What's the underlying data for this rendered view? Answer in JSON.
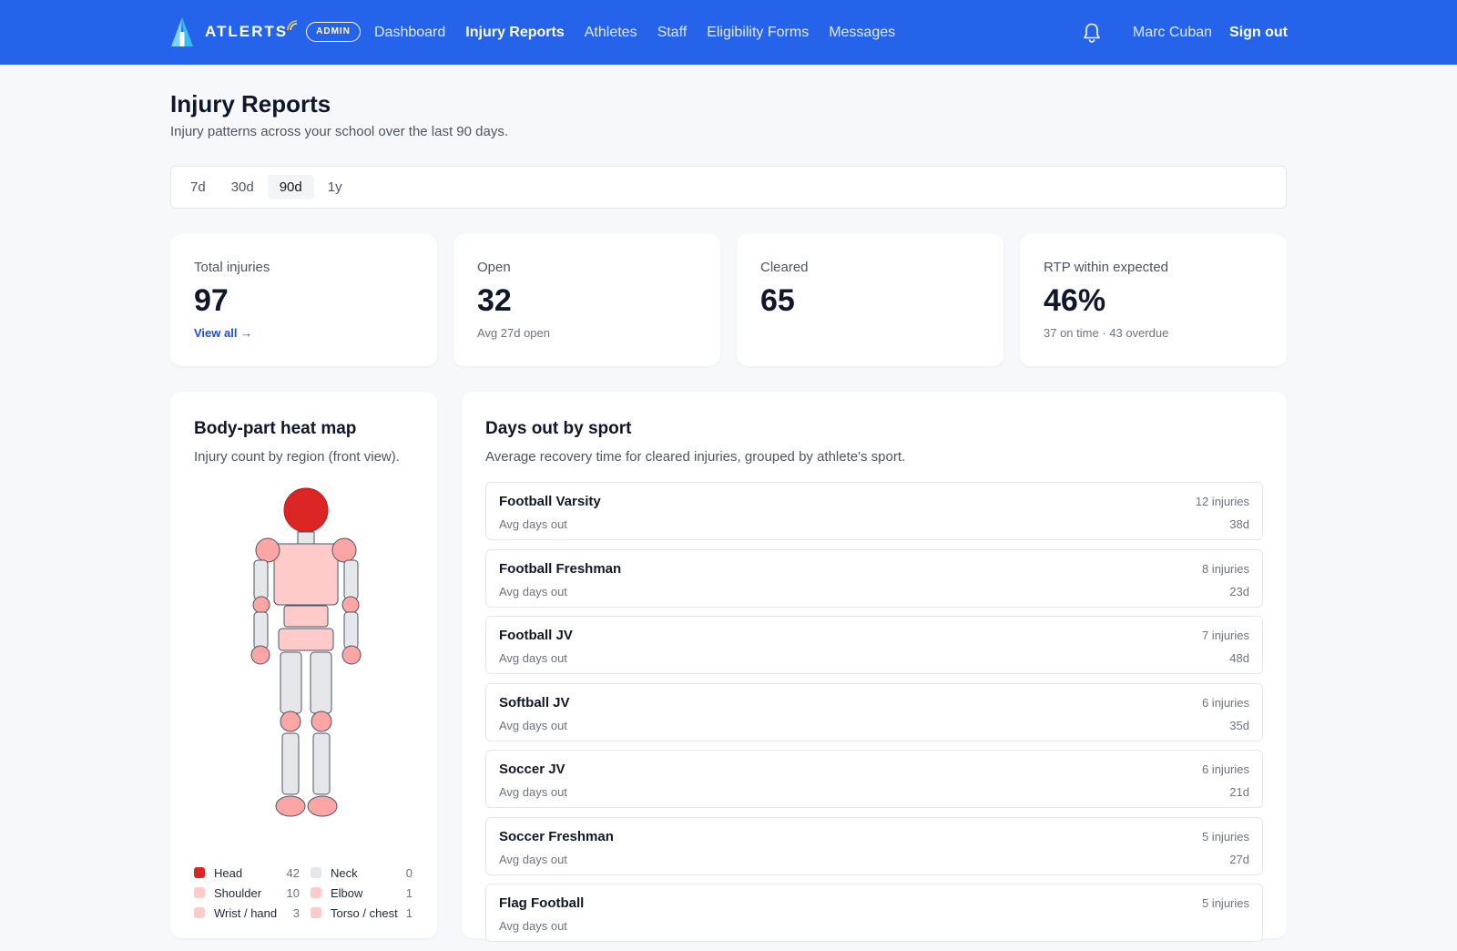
{
  "header": {
    "brand": "ATLERTS",
    "badge": "ADMIN",
    "nav": [
      {
        "label": "Dashboard",
        "active": false
      },
      {
        "label": "Injury Reports",
        "active": true
      },
      {
        "label": "Athletes",
        "active": false
      },
      {
        "label": "Staff",
        "active": false
      },
      {
        "label": "Eligibility Forms",
        "active": false
      },
      {
        "label": "Messages",
        "active": false
      }
    ],
    "icons": {
      "notifications": "bell-icon",
      "logo": "atlerts-logo-icon"
    },
    "user_name": "Marc Cuban",
    "sign_out": "Sign out",
    "accent_color": "#2563eb"
  },
  "page": {
    "title": "Injury Reports",
    "subtitle": "Injury patterns across your school over the last 90 days."
  },
  "range": {
    "tabs": [
      "7d",
      "30d",
      "90d",
      "1y"
    ],
    "selected": "90d"
  },
  "stats": {
    "total": {
      "label": "Total injuries",
      "value": "97",
      "link": "View all →"
    },
    "open": {
      "label": "Open",
      "value": "32",
      "foot": "Avg 27d open"
    },
    "cleared": {
      "label": "Cleared",
      "value": "65"
    },
    "rtp": {
      "label": "RTP within expected",
      "value": "46%",
      "foot": "37 on time · 43 overdue"
    }
  },
  "heatmap": {
    "title": "Body-part heat map",
    "subtitle": "Injury count by region (front view).",
    "colors": {
      "high": "#dc2626",
      "mid": "#fca5a5",
      "low": "#fecaca",
      "none": "#e5e7eb"
    },
    "legend": [
      [
        {
          "label": "Head",
          "count": "42",
          "color": "#dc2626"
        },
        {
          "label": "Neck",
          "count": "0",
          "color": "#e5e7eb"
        }
      ],
      [
        {
          "label": "Shoulder",
          "count": "10",
          "color": "#fecaca"
        },
        {
          "label": "Elbow",
          "count": "1",
          "color": "#fecaca"
        }
      ],
      [
        {
          "label": "Wrist / hand",
          "count": "3",
          "color": "#fecaca"
        },
        {
          "label": "Torso / chest",
          "count": "1",
          "color": "#fecaca"
        }
      ]
    ]
  },
  "sports": {
    "title": "Days out by sport",
    "subtitle": "Average recovery time for cleared injuries, grouped by athlete's sport.",
    "rows": [
      {
        "name": "Football Varsity",
        "sub": "Avg days out",
        "count": "12 injuries",
        "days": "38d"
      },
      {
        "name": "Football Freshman",
        "sub": "Avg days out",
        "count": "8 injuries",
        "days": "23d"
      },
      {
        "name": "Football JV",
        "sub": "Avg days out",
        "count": "7 injuries",
        "days": "48d"
      },
      {
        "name": "Softball JV",
        "sub": "Avg days out",
        "count": "6 injuries",
        "days": "35d"
      },
      {
        "name": "Soccer JV",
        "sub": "Avg days out",
        "count": "6 injuries",
        "days": "21d"
      },
      {
        "name": "Soccer Freshman",
        "sub": "Avg days out",
        "count": "5 injuries",
        "days": "27d"
      },
      {
        "name": "Flag Football",
        "sub": "Avg days out",
        "count": "5 injuries",
        "days": ""
      }
    ]
  }
}
